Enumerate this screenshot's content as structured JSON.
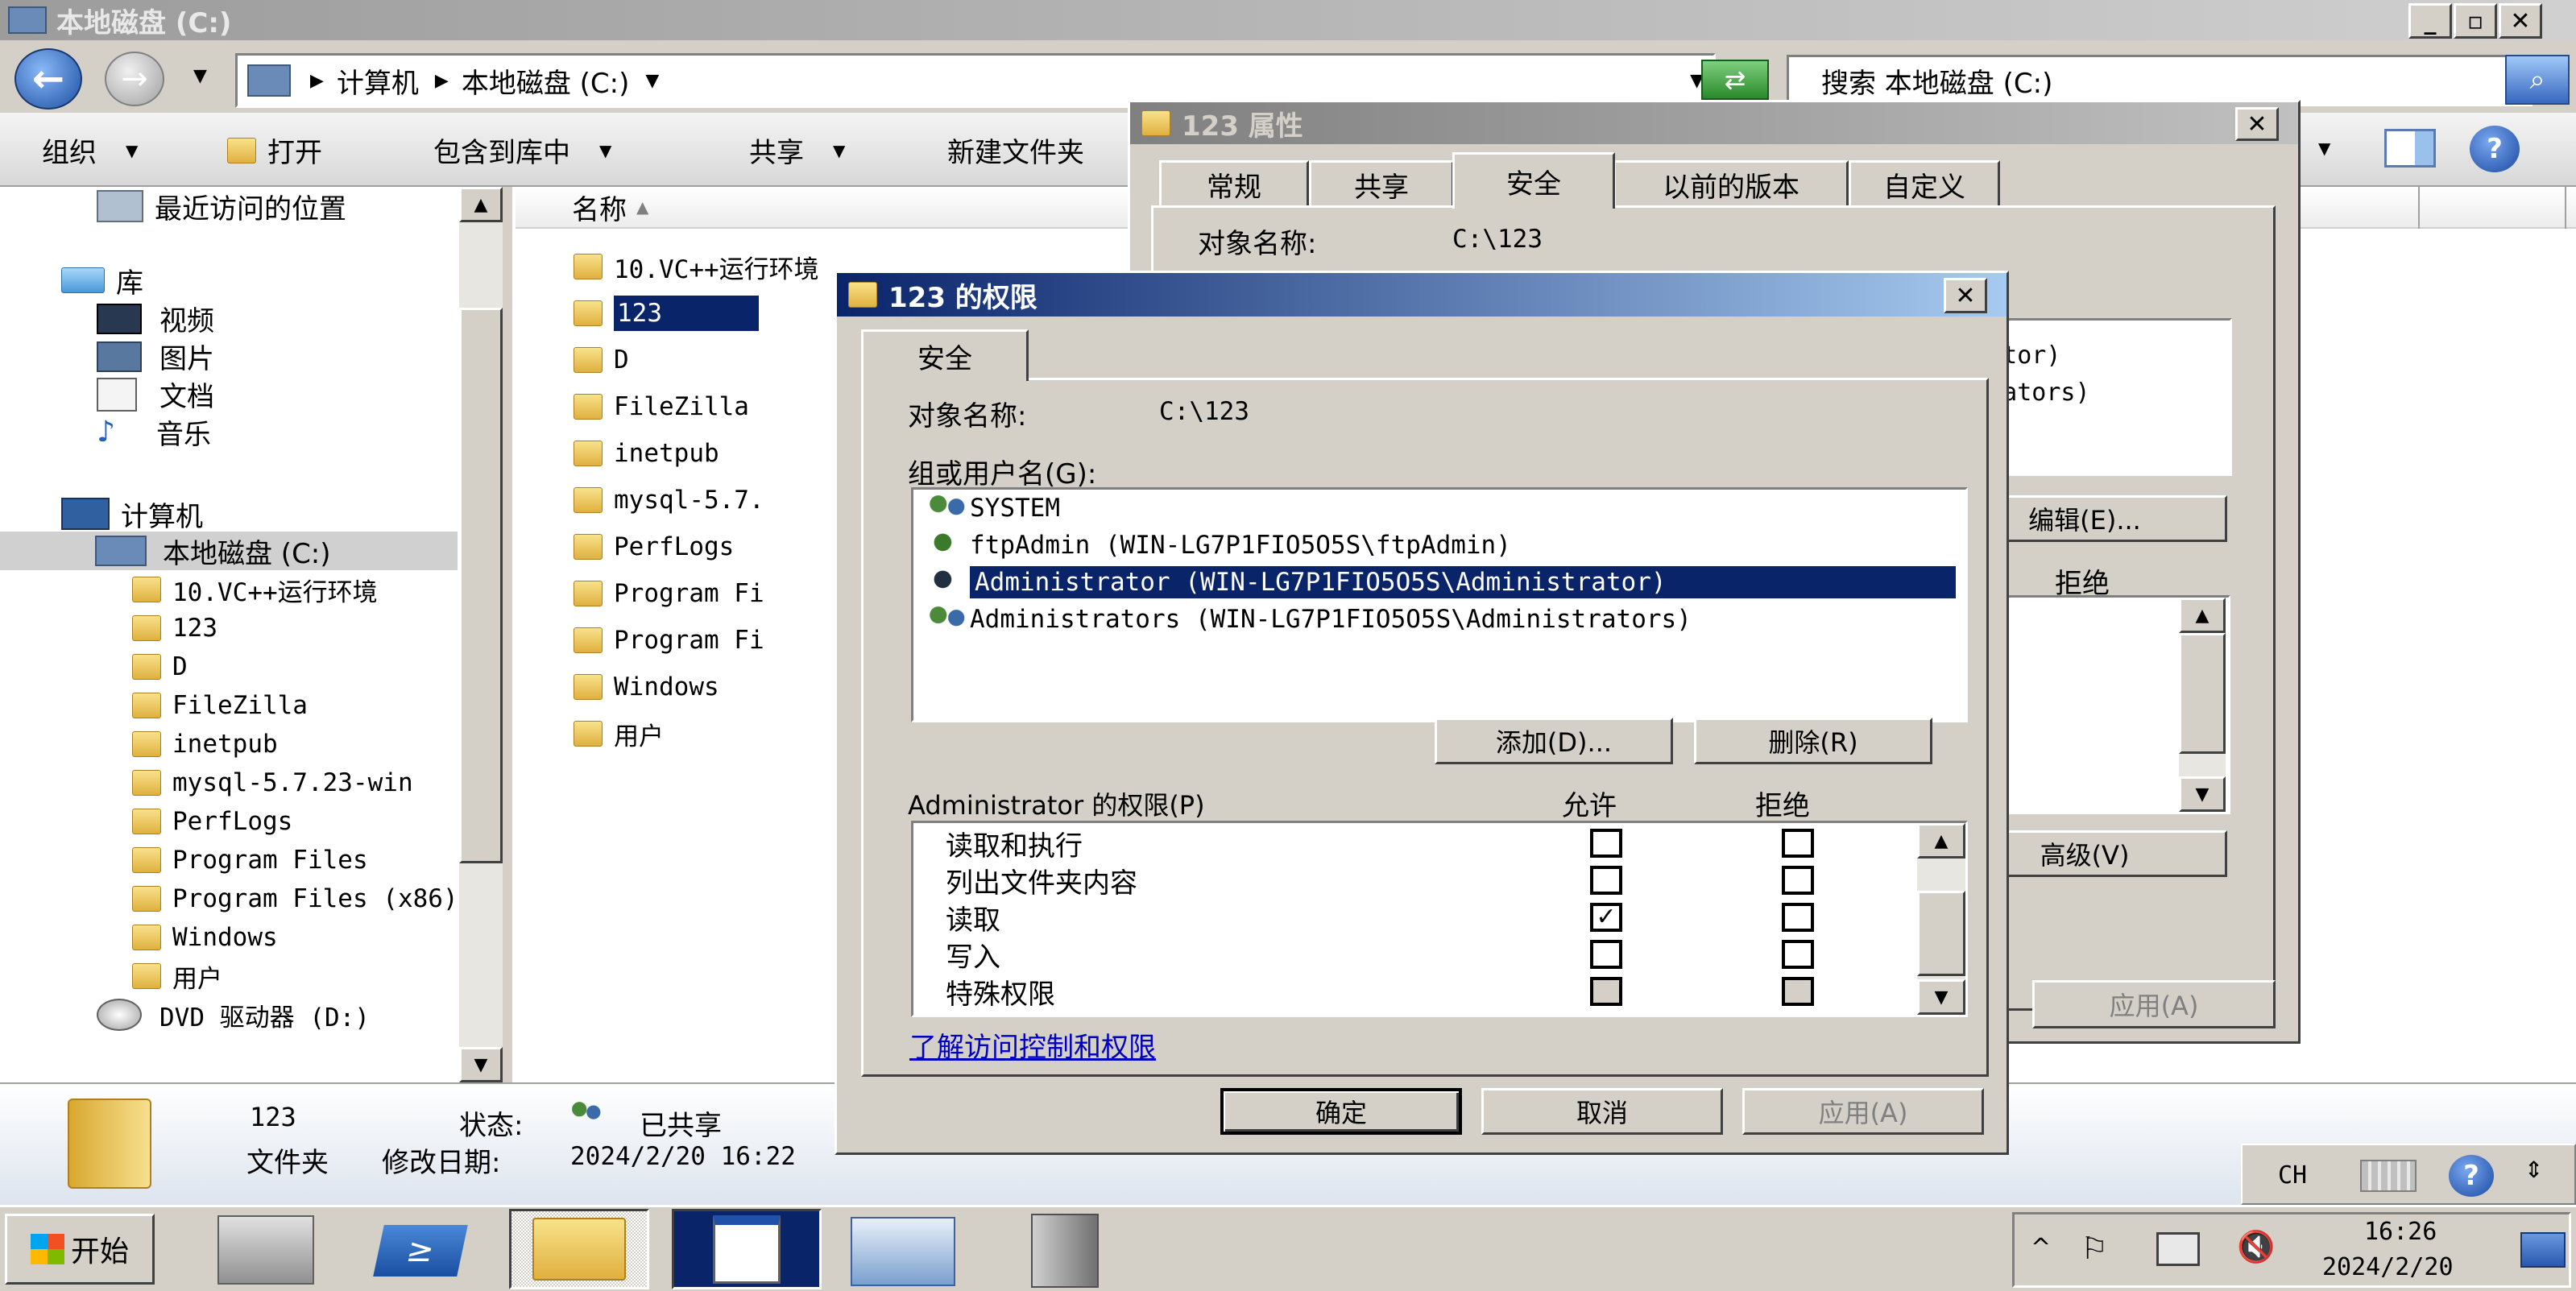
{
  "explorer": {
    "title": "本地磁盘 (C:)",
    "breadcrumb": [
      "计算机",
      "本地磁盘 (C:)"
    ],
    "search_placeholder": "搜索 本地磁盘 (C:)",
    "toolbar": {
      "organize": "组织",
      "open": "打开",
      "include": "包含到库中",
      "share": "共享",
      "newfolder": "新建文件夹"
    },
    "nav": {
      "recent": "最近访问的位置",
      "libraries": "库",
      "lib_items": [
        "视频",
        "图片",
        "文档",
        "音乐"
      ],
      "computer": "计算机",
      "drive_c": "本地磁盘 (C:)",
      "c_children": [
        "10.VC++运行环境",
        "123",
        "D",
        "FileZilla",
        "inetpub",
        "mysql-5.7.23-win",
        "PerfLogs",
        "Program Files",
        "Program Files (x86)",
        "Windows",
        "用户"
      ],
      "dvd": "DVD 驱动器 (D:)"
    },
    "column_name": "名称",
    "files": [
      "10.VC++运行环境",
      "123",
      "D",
      "FileZilla",
      "inetpub",
      "mysql-5.7.",
      "PerfLogs",
      "Program Fi",
      "Program Fi",
      "Windows",
      "用户"
    ],
    "details": {
      "name": "123",
      "status_label": "状态:",
      "status_value": "已共享",
      "type": "文件夹",
      "modified_label": "修改日期:",
      "modified_value": "2024/2/20 16:22"
    }
  },
  "props": {
    "title": "123 属性",
    "tabs": [
      "常规",
      "共享",
      "安全",
      "以前的版本",
      "自定义"
    ],
    "object_label": "对象名称:",
    "object_value": "C:\\123",
    "users_partial": [
      "trator)",
      "strators)"
    ],
    "edit_btn": "编辑(E)...",
    "deny_col": "拒绝",
    "advanced_btn": "高级(V)",
    "apply_btn": "应用(A)"
  },
  "perm": {
    "title": "123 的权限",
    "tab": "安全",
    "object_label": "对象名称:",
    "object_value": "C:\\123",
    "group_label": "组或用户名(G):",
    "users": [
      "SYSTEM",
      "ftpAdmin (WIN-LG7P1FIO5O5S\\ftpAdmin)",
      "Administrator (WIN-LG7P1FIO5O5S\\Administrator)",
      "Administrators (WIN-LG7P1FIO5O5S\\Administrators)"
    ],
    "add_btn": "添加(D)...",
    "remove_btn": "删除(R)",
    "perm_label": "Administrator 的权限(P)",
    "allow_col": "允许",
    "deny_col": "拒绝",
    "perms": [
      {
        "name": "读取和执行",
        "allow": "",
        "deny": ""
      },
      {
        "name": "列出文件夹内容",
        "allow": "",
        "deny": ""
      },
      {
        "name": "读取",
        "allow": "✓",
        "deny": ""
      },
      {
        "name": "写入",
        "allow": "",
        "deny": ""
      },
      {
        "name": "特殊权限",
        "allow": "",
        "deny": ""
      }
    ],
    "link": "了解访问控制和权限",
    "ok_btn": "确定",
    "cancel_btn": "取消",
    "apply_btn": "应用(A)"
  },
  "taskbar": {
    "start": "开始",
    "lang": "CH",
    "time": "16:26",
    "date": "2024/2/20"
  }
}
